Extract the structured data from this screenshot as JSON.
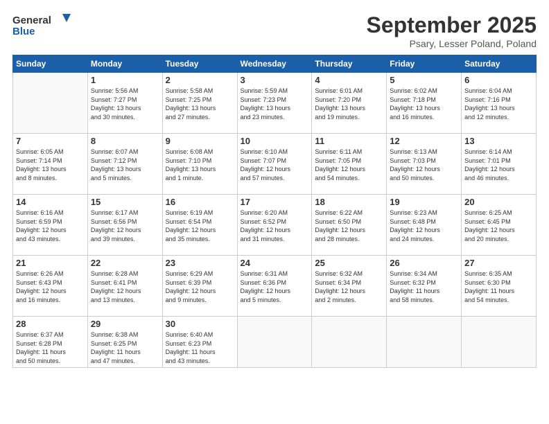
{
  "header": {
    "logo_line1": "General",
    "logo_line2": "Blue",
    "month": "September 2025",
    "location": "Psary, Lesser Poland, Poland"
  },
  "days_of_week": [
    "Sunday",
    "Monday",
    "Tuesday",
    "Wednesday",
    "Thursday",
    "Friday",
    "Saturday"
  ],
  "weeks": [
    [
      {
        "day": "",
        "info": ""
      },
      {
        "day": "1",
        "info": "Sunrise: 5:56 AM\nSunset: 7:27 PM\nDaylight: 13 hours\nand 30 minutes."
      },
      {
        "day": "2",
        "info": "Sunrise: 5:58 AM\nSunset: 7:25 PM\nDaylight: 13 hours\nand 27 minutes."
      },
      {
        "day": "3",
        "info": "Sunrise: 5:59 AM\nSunset: 7:23 PM\nDaylight: 13 hours\nand 23 minutes."
      },
      {
        "day": "4",
        "info": "Sunrise: 6:01 AM\nSunset: 7:20 PM\nDaylight: 13 hours\nand 19 minutes."
      },
      {
        "day": "5",
        "info": "Sunrise: 6:02 AM\nSunset: 7:18 PM\nDaylight: 13 hours\nand 16 minutes."
      },
      {
        "day": "6",
        "info": "Sunrise: 6:04 AM\nSunset: 7:16 PM\nDaylight: 13 hours\nand 12 minutes."
      }
    ],
    [
      {
        "day": "7",
        "info": "Sunrise: 6:05 AM\nSunset: 7:14 PM\nDaylight: 13 hours\nand 8 minutes."
      },
      {
        "day": "8",
        "info": "Sunrise: 6:07 AM\nSunset: 7:12 PM\nDaylight: 13 hours\nand 5 minutes."
      },
      {
        "day": "9",
        "info": "Sunrise: 6:08 AM\nSunset: 7:10 PM\nDaylight: 13 hours\nand 1 minute."
      },
      {
        "day": "10",
        "info": "Sunrise: 6:10 AM\nSunset: 7:07 PM\nDaylight: 12 hours\nand 57 minutes."
      },
      {
        "day": "11",
        "info": "Sunrise: 6:11 AM\nSunset: 7:05 PM\nDaylight: 12 hours\nand 54 minutes."
      },
      {
        "day": "12",
        "info": "Sunrise: 6:13 AM\nSunset: 7:03 PM\nDaylight: 12 hours\nand 50 minutes."
      },
      {
        "day": "13",
        "info": "Sunrise: 6:14 AM\nSunset: 7:01 PM\nDaylight: 12 hours\nand 46 minutes."
      }
    ],
    [
      {
        "day": "14",
        "info": "Sunrise: 6:16 AM\nSunset: 6:59 PM\nDaylight: 12 hours\nand 43 minutes."
      },
      {
        "day": "15",
        "info": "Sunrise: 6:17 AM\nSunset: 6:56 PM\nDaylight: 12 hours\nand 39 minutes."
      },
      {
        "day": "16",
        "info": "Sunrise: 6:19 AM\nSunset: 6:54 PM\nDaylight: 12 hours\nand 35 minutes."
      },
      {
        "day": "17",
        "info": "Sunrise: 6:20 AM\nSunset: 6:52 PM\nDaylight: 12 hours\nand 31 minutes."
      },
      {
        "day": "18",
        "info": "Sunrise: 6:22 AM\nSunset: 6:50 PM\nDaylight: 12 hours\nand 28 minutes."
      },
      {
        "day": "19",
        "info": "Sunrise: 6:23 AM\nSunset: 6:48 PM\nDaylight: 12 hours\nand 24 minutes."
      },
      {
        "day": "20",
        "info": "Sunrise: 6:25 AM\nSunset: 6:45 PM\nDaylight: 12 hours\nand 20 minutes."
      }
    ],
    [
      {
        "day": "21",
        "info": "Sunrise: 6:26 AM\nSunset: 6:43 PM\nDaylight: 12 hours\nand 16 minutes."
      },
      {
        "day": "22",
        "info": "Sunrise: 6:28 AM\nSunset: 6:41 PM\nDaylight: 12 hours\nand 13 minutes."
      },
      {
        "day": "23",
        "info": "Sunrise: 6:29 AM\nSunset: 6:39 PM\nDaylight: 12 hours\nand 9 minutes."
      },
      {
        "day": "24",
        "info": "Sunrise: 6:31 AM\nSunset: 6:36 PM\nDaylight: 12 hours\nand 5 minutes."
      },
      {
        "day": "25",
        "info": "Sunrise: 6:32 AM\nSunset: 6:34 PM\nDaylight: 12 hours\nand 2 minutes."
      },
      {
        "day": "26",
        "info": "Sunrise: 6:34 AM\nSunset: 6:32 PM\nDaylight: 11 hours\nand 58 minutes."
      },
      {
        "day": "27",
        "info": "Sunrise: 6:35 AM\nSunset: 6:30 PM\nDaylight: 11 hours\nand 54 minutes."
      }
    ],
    [
      {
        "day": "28",
        "info": "Sunrise: 6:37 AM\nSunset: 6:28 PM\nDaylight: 11 hours\nand 50 minutes."
      },
      {
        "day": "29",
        "info": "Sunrise: 6:38 AM\nSunset: 6:25 PM\nDaylight: 11 hours\nand 47 minutes."
      },
      {
        "day": "30",
        "info": "Sunrise: 6:40 AM\nSunset: 6:23 PM\nDaylight: 11 hours\nand 43 minutes."
      },
      {
        "day": "",
        "info": ""
      },
      {
        "day": "",
        "info": ""
      },
      {
        "day": "",
        "info": ""
      },
      {
        "day": "",
        "info": ""
      }
    ]
  ]
}
